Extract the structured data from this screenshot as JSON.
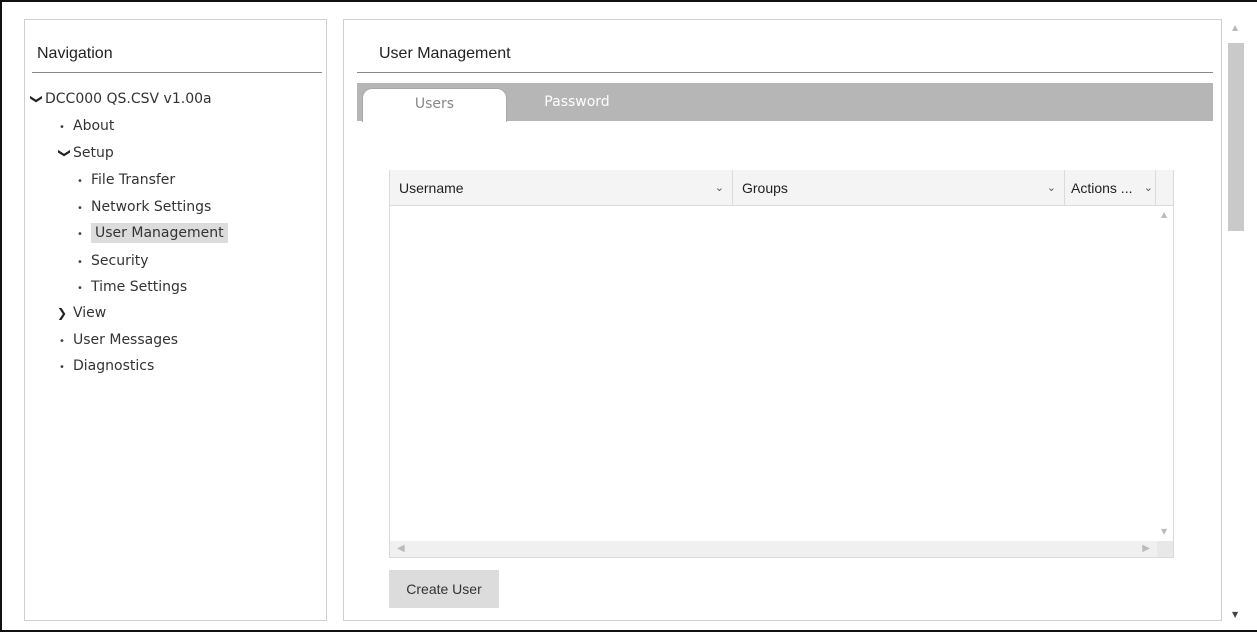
{
  "navigation": {
    "title": "Navigation",
    "tree": [
      {
        "label": "DCC000 QS.CSV v1.00a",
        "type": "expanded"
      },
      {
        "label": "About",
        "type": "leaf"
      },
      {
        "label": "Setup",
        "type": "expanded"
      },
      {
        "label": "File Transfer",
        "type": "leaf"
      },
      {
        "label": "Network Settings",
        "type": "leaf"
      },
      {
        "label": "User Management",
        "type": "leaf",
        "selected": true
      },
      {
        "label": "Security",
        "type": "leaf"
      },
      {
        "label": "Time Settings",
        "type": "leaf"
      },
      {
        "label": "View",
        "type": "collapsed"
      },
      {
        "label": "User Messages",
        "type": "leaf"
      },
      {
        "label": "Diagnostics",
        "type": "leaf"
      }
    ]
  },
  "main": {
    "title": "User Management",
    "tabs": [
      {
        "label": "Users",
        "active": true
      },
      {
        "label": "Password",
        "active": false
      }
    ],
    "table": {
      "columns": [
        "Username",
        "Groups",
        "Actions ..."
      ],
      "rows": []
    },
    "create_button": "Create User"
  },
  "icons": {
    "expanded": "chevron-down-icon",
    "collapsed": "chevron-right-icon",
    "sort": "chevron-down-icon"
  }
}
